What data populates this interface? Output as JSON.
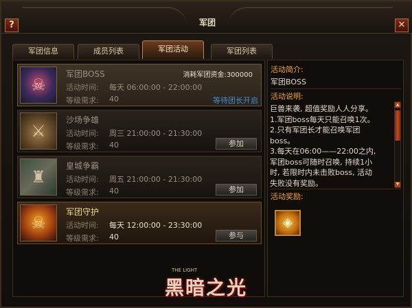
{
  "window": {
    "title": "军团",
    "help_label": "?",
    "close_label": "✕"
  },
  "tabs": [
    {
      "label": "军团信息",
      "active": false
    },
    {
      "label": "成员列表",
      "active": false
    },
    {
      "label": "军团活动",
      "active": true
    },
    {
      "label": "军团列表",
      "active": false
    }
  ],
  "activities": [
    {
      "name": "军团BOSS",
      "icon": "boss-icon",
      "cost_label": "消耗军团资金:300000",
      "time_label": "活动时间:",
      "time": "每天 06:00:00 - 22:00:00",
      "level_label": "等级需求:",
      "level": "40",
      "status": "等待团长开启"
    },
    {
      "name": "沙场争雄",
      "icon": "battlefield-icon",
      "time_label": "活动时间:",
      "time": "周三 21:00:00 - 21:30:00",
      "level_label": "等级需求:",
      "level": "40",
      "button": "参加"
    },
    {
      "name": "皇城争霸",
      "icon": "castle-icon",
      "time_label": "活动时间:",
      "time": "周五 21:00:00 - 21:30:00",
      "level_label": "等级需求:",
      "level": "40",
      "button": "参加"
    },
    {
      "name": "军团守护",
      "icon": "skull-icon",
      "time_label": "活动时间:",
      "time": "每天 12:00:00 - 23:30:00",
      "level_label": "等级需求:",
      "level": "40",
      "button": "参与"
    }
  ],
  "info": {
    "intro_title": "活动简介:",
    "intro": "军团BOSS",
    "desc_title": "活动说明:",
    "desc_lines": [
      "巨兽来袭, 超值奖励人人分享。",
      " 1.军团boss每天只能召唤1次。",
      " 2.只有军团长才能召唤军团",
      "boss。",
      " 3.每天在06:00——22:00之内,",
      "军团boss可随时召唤, 持续1小",
      "时, 若限时内未击败boss, 活动",
      "失败没有奖励。"
    ],
    "reward_title": "活动奖励:",
    "reward_icon": "treasure-chest-icon"
  },
  "logo": {
    "text": "黑暗之光",
    "sub": "THE LIGHT"
  }
}
